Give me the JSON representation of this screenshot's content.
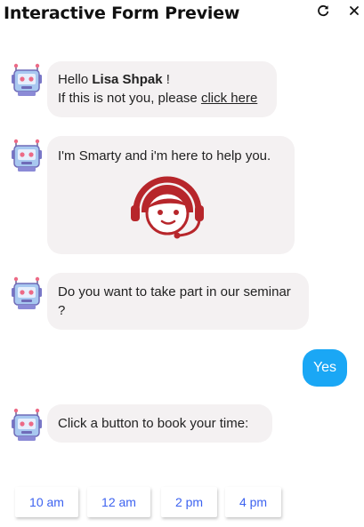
{
  "window": {
    "title": "Interactive Form Preview",
    "icons": {
      "reload": "reload-icon",
      "close": "close-icon"
    }
  },
  "messages": {
    "greeting": {
      "hello": "Hello",
      "user_name": "Lisa Shpak",
      "exclaim": "!",
      "line2_prefix": "If this is not you, please",
      "link_text": "click here"
    },
    "intro": {
      "text": "I'm Smarty and i'm here to help you."
    },
    "question": {
      "text": "Do you want to take part in our seminar ?"
    },
    "user_reply": {
      "text": "Yes"
    },
    "booking": {
      "text": "Click a button to book your time:"
    }
  },
  "time_slots": [
    "10 am",
    "12 am",
    "2 pm",
    "4 pm"
  ],
  "colors": {
    "bubble_bg": "#f4f1f2",
    "user_bubble": "#1aa7f5",
    "slot_text": "#3d63f0",
    "agent_icon": "#b7262b"
  }
}
